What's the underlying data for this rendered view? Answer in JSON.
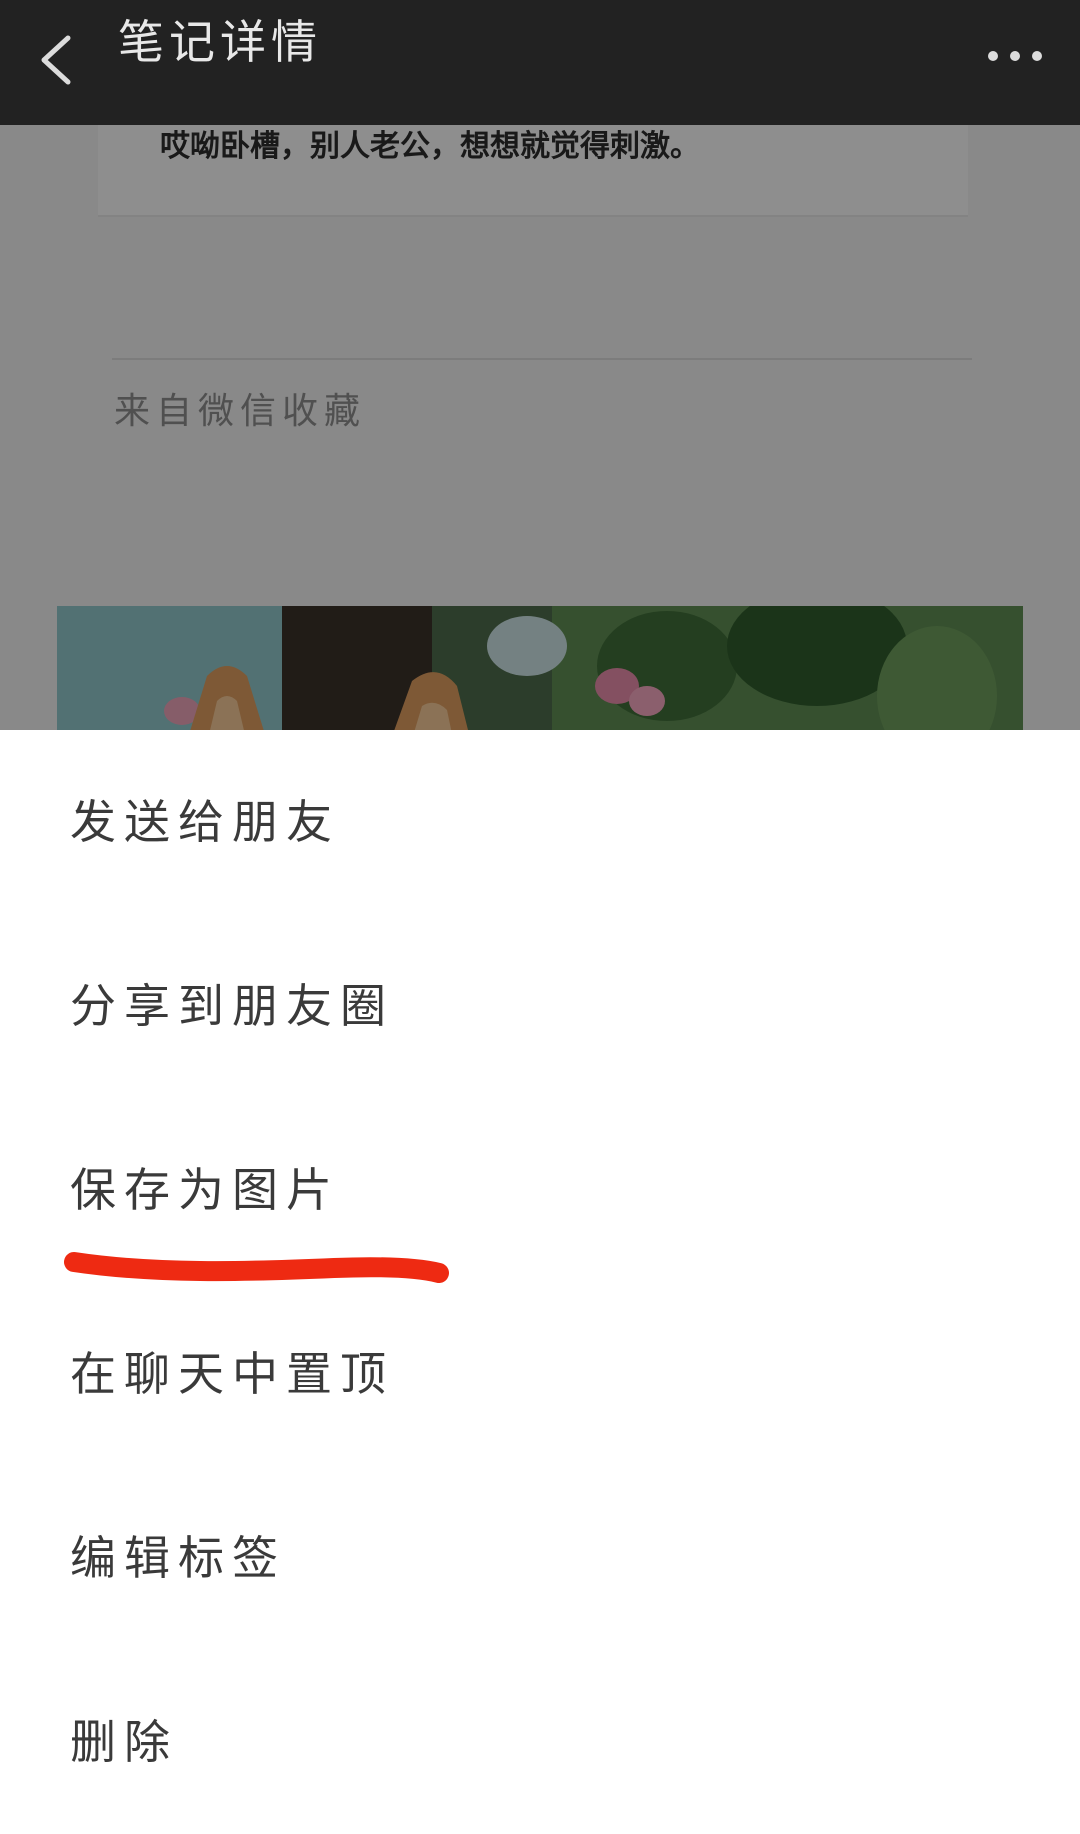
{
  "header": {
    "back_icon": "chevron-left-icon",
    "title": "笔记详情",
    "more_icon": "more-horizontal-icon"
  },
  "note": {
    "text": "哎呦卧槽，别人老公，想想就觉得刺激。",
    "source": "来自微信收藏",
    "image": "dog-ears-photo"
  },
  "menu": {
    "items": [
      {
        "label": "发送给朋友"
      },
      {
        "label": "分享到朋友圈"
      },
      {
        "label": "保存为图片"
      },
      {
        "label": "在聊天中置顶"
      },
      {
        "label": "编辑标签"
      },
      {
        "label": "删除"
      }
    ]
  },
  "annotation": {
    "highlight_color": "#ee2a12"
  },
  "colors": {
    "topbar": "#222222",
    "overlay": "rgba(0,0,0,0.42)",
    "sheet": "#ffffff"
  }
}
